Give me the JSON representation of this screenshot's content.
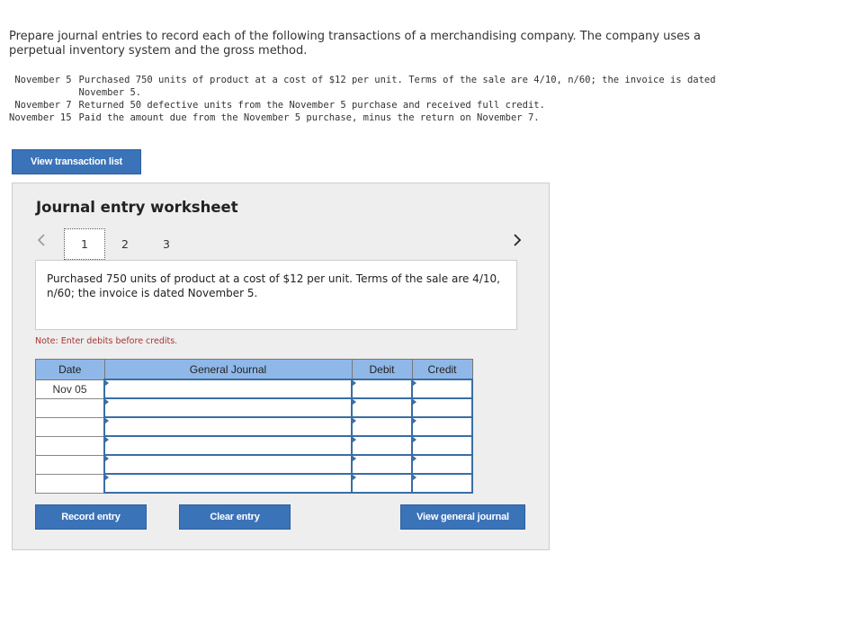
{
  "intro": "Prepare journal entries to record each of the following transactions of a merchandising company. The company uses a perpetual inventory system and the gross method.",
  "transactions": [
    {
      "date": "November 5",
      "text": "Purchased 750 units of product at a cost of $12 per unit. Terms of the sale are 4/10, n/60; the invoice is dated November 5."
    },
    {
      "date": "November 7",
      "text": "Returned 50 defective units from the November 5 purchase and received full credit."
    },
    {
      "date": "November 15",
      "text": "Paid the amount due from the November 5 purchase, minus the return on November 7."
    }
  ],
  "view_list_label": "View transaction list",
  "worksheet": {
    "title": "Journal entry worksheet",
    "tabs": [
      "1",
      "2",
      "3"
    ],
    "description": "Purchased 750 units of product at a cost of $12 per unit. Terms of the sale are 4/10, n/60; the invoice is dated November 5.",
    "note": "Note: Enter debits before credits.",
    "table": {
      "headers": {
        "date": "Date",
        "account": "General Journal",
        "debit": "Debit",
        "credit": "Credit"
      },
      "rows": [
        {
          "date": "Nov 05",
          "account": "",
          "debit": "",
          "credit": ""
        },
        {
          "date": "",
          "account": "",
          "debit": "",
          "credit": ""
        },
        {
          "date": "",
          "account": "",
          "debit": "",
          "credit": ""
        },
        {
          "date": "",
          "account": "",
          "debit": "",
          "credit": ""
        },
        {
          "date": "",
          "account": "",
          "debit": "",
          "credit": ""
        },
        {
          "date": "",
          "account": "",
          "debit": "",
          "credit": ""
        }
      ]
    },
    "buttons": {
      "record": "Record entry",
      "clear": "Clear entry",
      "view_journal": "View general journal"
    }
  },
  "colors": {
    "button": "#3b73b9",
    "header": "#8fb8e8",
    "note": "#aa3333"
  }
}
